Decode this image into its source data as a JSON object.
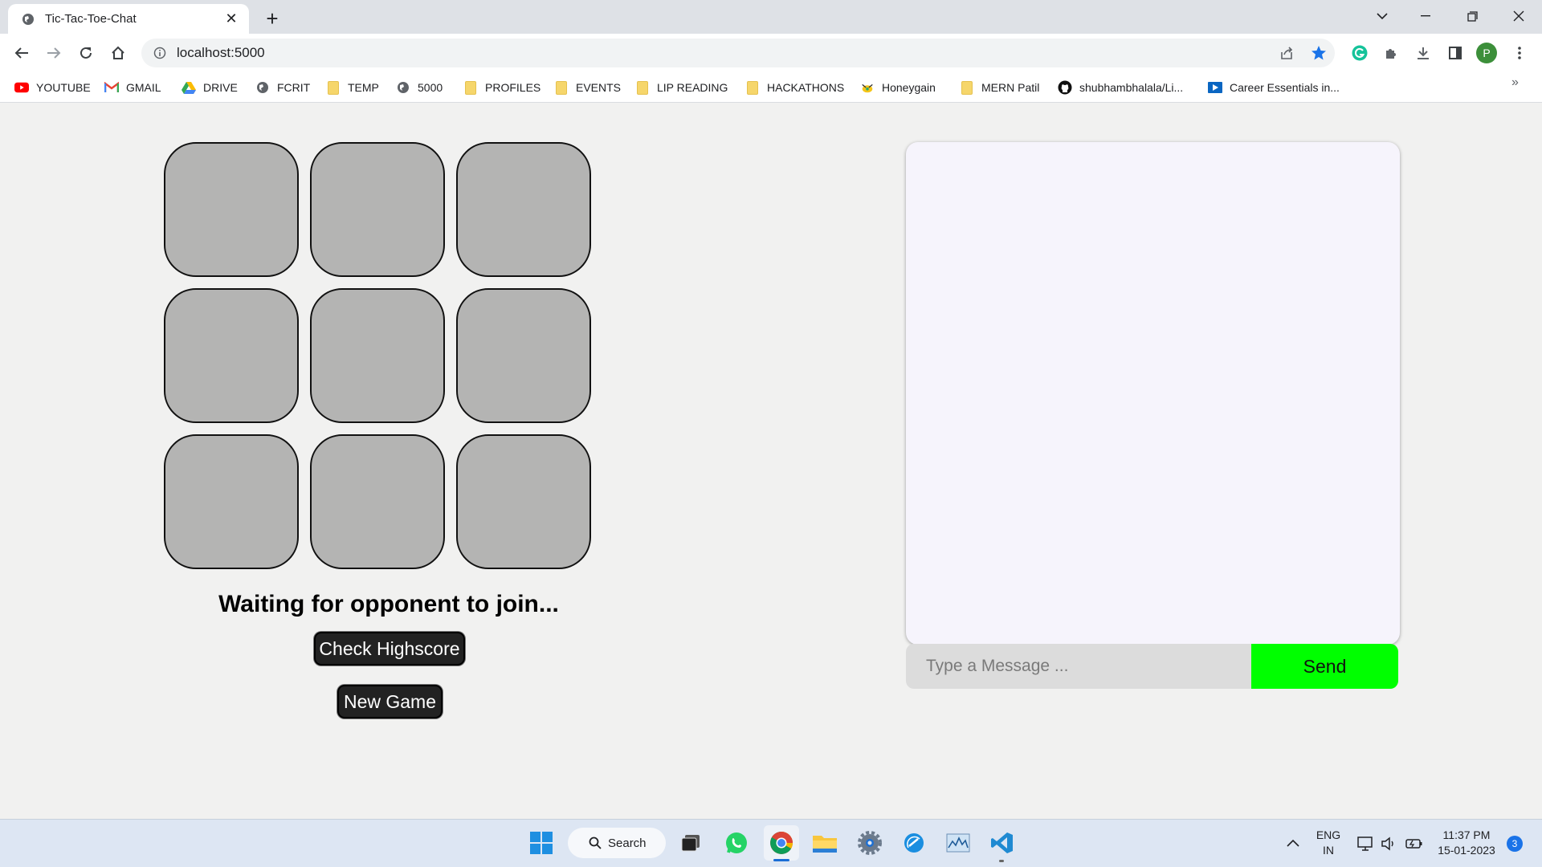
{
  "browser": {
    "tab_title": "Tic-Tac-Toe-Chat",
    "url": "localhost:5000",
    "profile_initial": "P",
    "bookmarks": [
      {
        "label": "YOUTUBE",
        "icon": "youtube-icon"
      },
      {
        "label": "GMAIL",
        "icon": "gmail-icon"
      },
      {
        "label": "DRIVE",
        "icon": "drive-icon"
      },
      {
        "label": "FCRIT",
        "icon": "globe-icon"
      },
      {
        "label": "TEMP",
        "icon": "folder-icon"
      },
      {
        "label": "5000",
        "icon": "globe-icon"
      },
      {
        "label": "PROFILES",
        "icon": "folder-icon"
      },
      {
        "label": "EVENTS",
        "icon": "folder-icon"
      },
      {
        "label": "LIP READING",
        "icon": "folder-icon"
      },
      {
        "label": "HACKATHONS",
        "icon": "folder-icon"
      },
      {
        "label": "Honeygain",
        "icon": "honeygain-icon"
      },
      {
        "label": "MERN Patil",
        "icon": "folder-icon"
      },
      {
        "label": "shubhambhalala/Li...",
        "icon": "github-icon"
      },
      {
        "label": "Career Essentials in...",
        "icon": "linkedin-learning-icon"
      }
    ]
  },
  "game": {
    "cells": [
      "",
      "",
      "",
      "",
      "",
      "",
      "",
      "",
      ""
    ],
    "status": "Waiting for opponent to join...",
    "highscore_label": "Check Highscore",
    "new_game_label": "New Game"
  },
  "chat": {
    "messages": [],
    "input_placeholder": "Type a Message ...",
    "send_label": "Send",
    "send_color": "#00ff00"
  },
  "taskbar": {
    "search_label": "Search",
    "lang_top": "ENG",
    "lang_bottom": "IN",
    "time": "11:37 PM",
    "date": "15-01-2023",
    "notifications": "3"
  }
}
